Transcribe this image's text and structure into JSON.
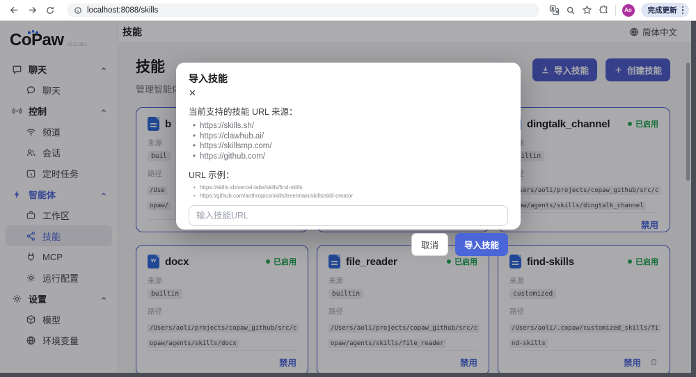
{
  "browser": {
    "url": "localhost:8088/skills",
    "update_label": "完成更新",
    "avatar_initials": "Ao"
  },
  "logo": {
    "name": "CoPaw",
    "version": "v0.0.3b1"
  },
  "topbar": {
    "nav_title": "技能",
    "language": "简体中文"
  },
  "sidebar": {
    "rows": [
      {
        "label": "聊天"
      },
      {
        "label": "聊天"
      },
      {
        "label": "控制"
      },
      {
        "label": "频道"
      },
      {
        "label": "会话"
      },
      {
        "label": "定时任务"
      },
      {
        "label": "智能体"
      },
      {
        "label": "工作区"
      },
      {
        "label": "技能"
      },
      {
        "label": "MCP"
      },
      {
        "label": "运行配置"
      },
      {
        "label": "设置"
      },
      {
        "label": "模型"
      },
      {
        "label": "环境变量"
      }
    ]
  },
  "page": {
    "title": "技能",
    "subtitle": "管理智能体技",
    "import_label": "导入技能",
    "create_label": "创建技能"
  },
  "labels": {
    "source": "来源",
    "path": "路径",
    "disable": "禁用",
    "enabled": "已启用"
  },
  "cards": {
    "partial": {
      "title": "b",
      "source": "buil",
      "path_line1": "/Use",
      "path_line2": "opaw/"
    },
    "dingtalk": {
      "title": "dingtalk_channel",
      "source": "builtin",
      "path_line1": "/Users/aoli/projects/copaw_github/src/c",
      "path_line2": "opaw/agents/skills/dingtalk_channel"
    },
    "docx": {
      "title": "docx",
      "icon_letter": "w",
      "source": "builtin",
      "path_line1": "/Users/aoli/projects/copaw_github/src/c",
      "path_line2": "opaw/agents/skills/docx"
    },
    "file_reader": {
      "title": "file_reader",
      "source": "builtin",
      "path_line1": "/Users/aoli/projects/copaw_github/src/c",
      "path_line2": "opaw/agents/skills/file_reader"
    },
    "find_skills": {
      "title": "find-skills",
      "source": "customized",
      "path_line1": "/Users/aoli/.copaw/customized_skills/fi",
      "path_line2": "nd-skills"
    }
  },
  "modal": {
    "title": "导入技能",
    "close_icon": "✕",
    "lead": "当前支持的技能 URL 来源：",
    "sources": [
      "https://skills.sh/",
      "https://clawhub.ai/",
      "https://skillsmp.com/",
      "https://github.com/"
    ],
    "examples_label": "URL 示例：",
    "examples": [
      "https://skills.sh/vercel-labs/skills/find-skills",
      "https://github.com/anthropics/skills/tree/main/skills/skill-creator"
    ],
    "input_placeholder": "输入技能URL",
    "cancel_label": "取消",
    "confirm_label": "导入技能"
  },
  "colors": {
    "primary": "#4a66d8",
    "card_border": "#4657cc",
    "enabled_green": "#1ea550"
  }
}
